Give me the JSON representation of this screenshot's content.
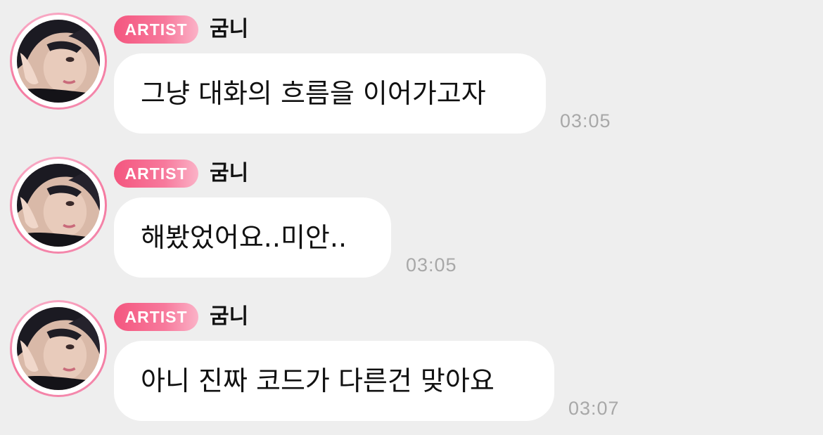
{
  "messages": [
    {
      "badge": "ARTIST",
      "sender": "굼니",
      "text": "그냥 대화의 흐름을 이어가고자",
      "time": "03:05"
    },
    {
      "badge": "ARTIST",
      "sender": "굼니",
      "text": "해봤었어요..미안..",
      "time": "03:05"
    },
    {
      "badge": "ARTIST",
      "sender": "굼니",
      "text": "아니 진짜 코드가 다른건 맞아요",
      "time": "03:07"
    }
  ],
  "colors": {
    "background": "#eeeeee",
    "bubble": "#ffffff",
    "badge_accent": "#f4567f",
    "time_text": "#a8a8a8"
  }
}
